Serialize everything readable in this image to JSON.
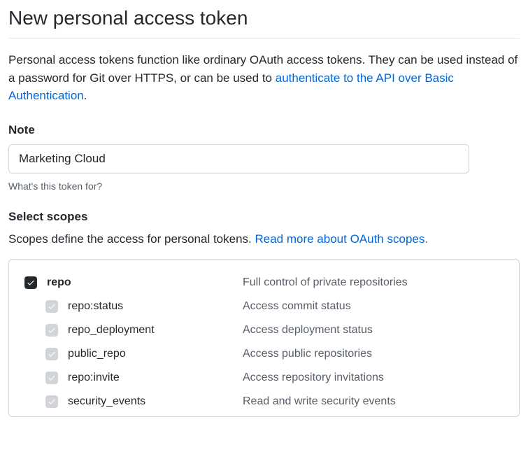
{
  "title": "New personal access token",
  "description_before_link": "Personal access tokens function like ordinary OAuth access tokens. They can be used instead of a password for Git over HTTPS, or can be used to ",
  "description_link": "authenticate to the API over Basic Authentication",
  "description_after_link": ".",
  "note": {
    "label": "Note",
    "value": "Marketing Cloud",
    "hint": "What's this token for?"
  },
  "scopes": {
    "label": "Select scopes",
    "description_before_link": "Scopes define the access for personal tokens. ",
    "description_link": "Read more about OAuth scopes.",
    "groups": [
      {
        "name": "repo",
        "description": "Full control of private repositories",
        "checked": true,
        "children": [
          {
            "name": "repo:status",
            "description": "Access commit status"
          },
          {
            "name": "repo_deployment",
            "description": "Access deployment status"
          },
          {
            "name": "public_repo",
            "description": "Access public repositories"
          },
          {
            "name": "repo:invite",
            "description": "Access repository invitations"
          },
          {
            "name": "security_events",
            "description": "Read and write security events"
          }
        ]
      }
    ]
  }
}
